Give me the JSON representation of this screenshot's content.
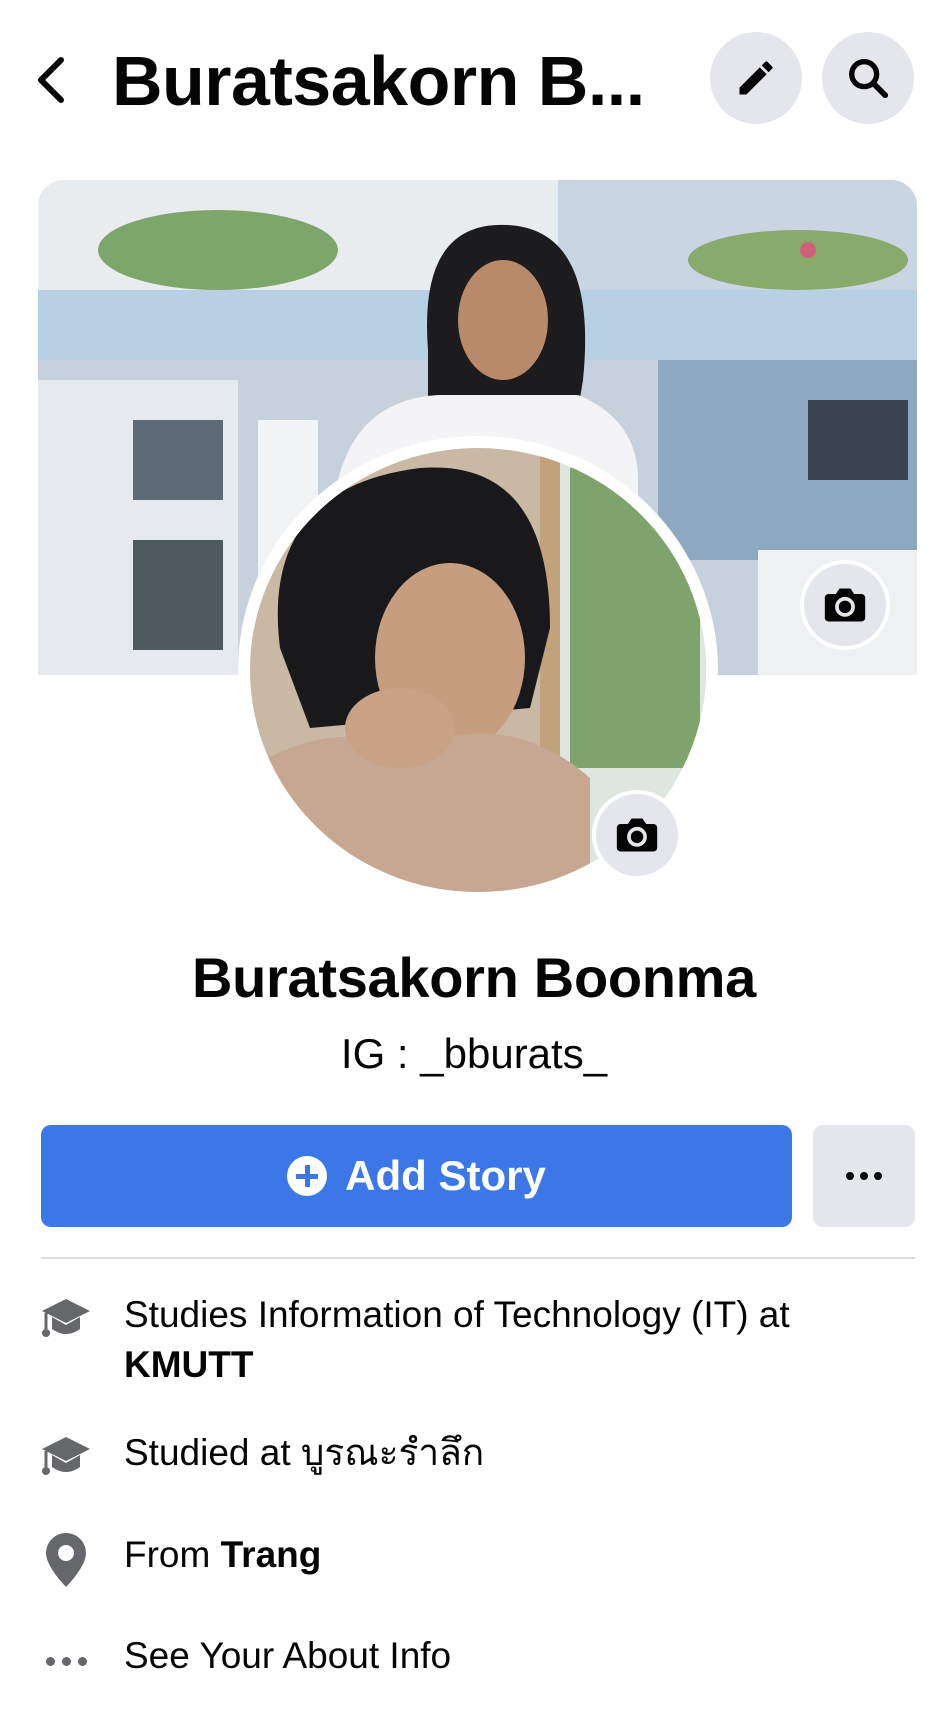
{
  "header": {
    "title": "Buratsakorn B...",
    "back_icon": "chevron-left-icon",
    "edit_icon": "pencil-icon",
    "search_icon": "search-icon"
  },
  "profile": {
    "name": "Buratsakorn Boonma",
    "bio": "IG : _bburats_"
  },
  "actions": {
    "add_story_label": "Add Story",
    "more_icon": "more-icon"
  },
  "info": {
    "studies_prefix": "Studies Information of Technology (IT) at",
    "studies_place": "KMUTT",
    "studied_prefix": "Studied at",
    "studied_place": "บูรณะรำลึก",
    "from_prefix": "From",
    "from_place": "Trang",
    "about_link": "See Your About Info"
  },
  "colors": {
    "primary": "#3b77e6",
    "button_gray": "#e4e6eb",
    "icon_gray": "#65676b"
  }
}
